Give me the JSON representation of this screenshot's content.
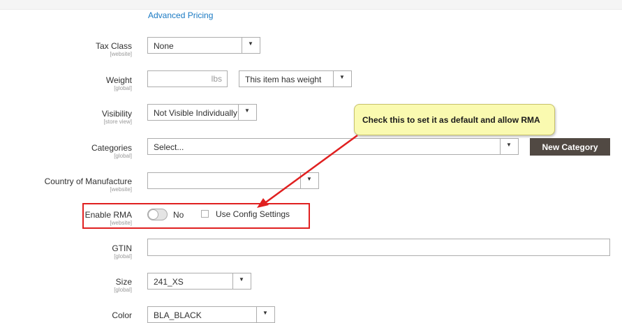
{
  "link": {
    "advanced_pricing": "Advanced Pricing"
  },
  "fields": {
    "tax_class": {
      "label": "Tax Class",
      "scope": "[website]",
      "value": "None"
    },
    "weight": {
      "label": "Weight",
      "scope": "[global]",
      "unit": "lbs",
      "value": "",
      "type_value": "This item has weight"
    },
    "visibility": {
      "label": "Visibility",
      "scope": "[store view]",
      "value": "Not Visible Individually"
    },
    "categories": {
      "label": "Categories",
      "scope": "[global]",
      "value": "Select...",
      "button": "New Category"
    },
    "country": {
      "label": "Country of Manufacture",
      "scope": "[website]",
      "value": ""
    },
    "enable_rma": {
      "label": "Enable RMA",
      "scope": "[website]",
      "toggle_text": "No",
      "use_config": "Use Config Settings",
      "enabled": false,
      "use_config_checked": false
    },
    "gtin": {
      "label": "GTIN",
      "scope": "[global]",
      "value": ""
    },
    "size": {
      "label": "Size",
      "scope": "[global]",
      "value": "241_XS"
    },
    "color": {
      "label": "Color",
      "value": "BLA_BLACK"
    }
  },
  "callout": {
    "text": "Check this to set it as default and allow RMA"
  },
  "colors": {
    "link": "#1979c3",
    "button_bg": "#514943",
    "highlight": "#e02020",
    "callout_bg": "#fafab0"
  },
  "icons": {
    "select_arrow": "triangle-down"
  }
}
